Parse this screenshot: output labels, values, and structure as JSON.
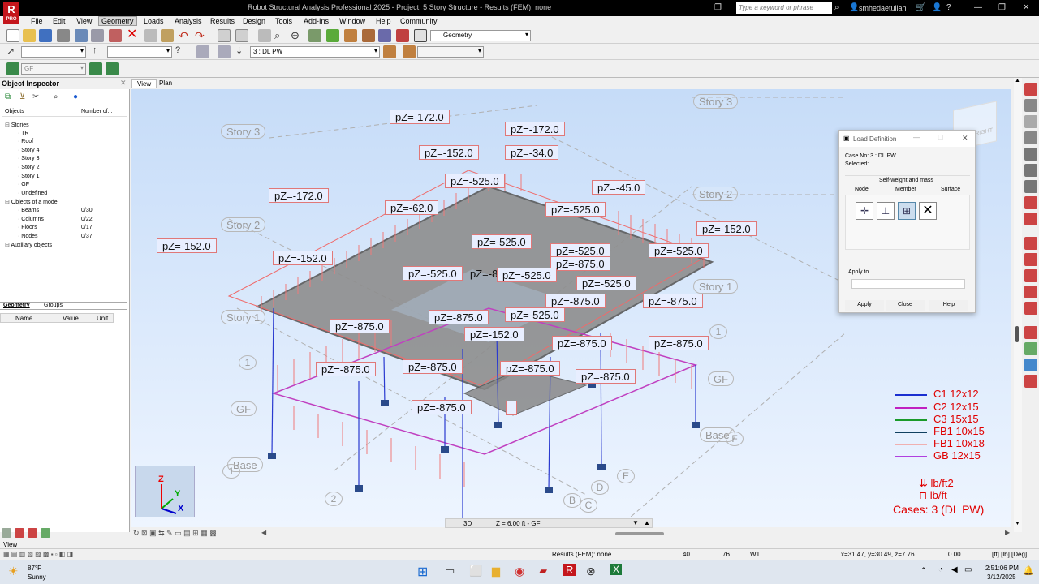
{
  "window": {
    "title": "Robot Structural Analysis Professional 2025 - Project: 5 Story Structure - Results (FEM): none",
    "search_placeholder": "Type a keyword or phrase",
    "user": "smhedaetullah"
  },
  "logo": {
    "letter": "R",
    "sub": "PRO"
  },
  "menu": [
    "File",
    "Edit",
    "View",
    "Geometry",
    "Loads",
    "Analysis",
    "Results",
    "Design",
    "Tools",
    "Add-Ins",
    "Window",
    "Help",
    "Community"
  ],
  "menu_active": "Geometry",
  "toolbar": {
    "layout_combo": "Geometry",
    "case_combo": "3 : DL PW",
    "story_combo": "GF"
  },
  "inspector": {
    "title": "Object Inspector",
    "cols": [
      "Objects",
      "Number of..."
    ],
    "tree": [
      {
        "label": "Stories",
        "level": 1,
        "count": ""
      },
      {
        "label": "TR",
        "level": 2,
        "count": ""
      },
      {
        "label": "Roof",
        "level": 2,
        "count": ""
      },
      {
        "label": "Story 4",
        "level": 2,
        "count": ""
      },
      {
        "label": "Story 3",
        "level": 2,
        "count": ""
      },
      {
        "label": "Story 2",
        "level": 2,
        "count": ""
      },
      {
        "label": "Story 1",
        "level": 2,
        "count": ""
      },
      {
        "label": "GF",
        "level": 2,
        "count": ""
      },
      {
        "label": "Undefined",
        "level": 2,
        "count": ""
      },
      {
        "label": "Objects of a model",
        "level": 1,
        "count": ""
      },
      {
        "label": "Beams",
        "level": 2,
        "count": "0/30"
      },
      {
        "label": "Columns",
        "level": 2,
        "count": "0/22"
      },
      {
        "label": "Floors",
        "level": 2,
        "count": "0/17"
      },
      {
        "label": "Nodes",
        "level": 2,
        "count": "0/37"
      },
      {
        "label": "Auxiliary objects",
        "level": 1,
        "count": ""
      }
    ],
    "tabs": [
      "Geometry",
      "Groups"
    ],
    "prop_cols": [
      "Name",
      "Value",
      "Unit"
    ]
  },
  "view_tabs": [
    "View",
    "Plan"
  ],
  "loads": [
    {
      "t": "pZ=-172.0"
    },
    {
      "t": "pZ=-172.0"
    },
    {
      "t": "pZ=-152.0"
    },
    {
      "t": "pZ=-34.0"
    },
    {
      "t": "pZ=-525.0"
    },
    {
      "t": "pZ=-172.0"
    },
    {
      "t": "pZ=-45.0"
    },
    {
      "t": "pZ=-62.0"
    },
    {
      "t": "pZ=-525.0"
    },
    {
      "t": "pZ=-152.0"
    },
    {
      "t": "pZ=-152.0"
    },
    {
      "t": "pZ=-525.0"
    },
    {
      "t": "pZ=-152.0"
    },
    {
      "t": "pZ=-525.0"
    },
    {
      "t": "pZ=-875.0"
    },
    {
      "t": "pZ=-525.0"
    },
    {
      "t": "pZ=-525.0"
    },
    {
      "t": "pZ=-875"
    },
    {
      "t": "pZ=-525.0"
    },
    {
      "t": "pZ=-525.0"
    },
    {
      "t": "pZ=-875.0"
    },
    {
      "t": "pZ=-875.0"
    },
    {
      "t": "pZ=-875.0"
    },
    {
      "t": "pZ=-525.0"
    },
    {
      "t": "pZ=-875.0"
    },
    {
      "t": "pZ=-152.0"
    },
    {
      "t": "pZ=-875.0"
    },
    {
      "t": "pZ=-875.0"
    },
    {
      "t": "pZ=-875.0"
    },
    {
      "t": "pZ=-875.0"
    },
    {
      "t": "pZ=-875.0"
    },
    {
      "t": "pZ=-875.0"
    },
    {
      "t": "pZ=-875.0"
    }
  ],
  "stories": [
    "Story 3",
    "Story 3",
    "Story 2",
    "Story 2",
    "Story 1",
    "Story 1",
    "GF",
    "GF",
    "Base",
    "Base"
  ],
  "grid_marks": [
    "1",
    "1",
    "2",
    "B",
    "C",
    "D",
    "E",
    "1",
    "F"
  ],
  "legend": {
    "items": [
      {
        "label": "C1 12x12",
        "color": "#1a2fd0"
      },
      {
        "label": "C2 12x15",
        "color": "#c020c0"
      },
      {
        "label": "C3 15x15",
        "color": "#1a9a2a"
      },
      {
        "label": "FB1 10x15",
        "color": "#104060"
      },
      {
        "label": "FB1 10x18",
        "color": "#f0b0b0"
      },
      {
        "label": "GB 12x15",
        "color": "#b040e0"
      }
    ],
    "units": [
      "lb/ft2",
      "lb/ft"
    ],
    "cases": "Cases: 3 (DL PW)"
  },
  "dialog": {
    "title": "Load Definition",
    "case": "Case No: 3 : DL PW",
    "selected": "Selected:",
    "group": "Self-weight and mass",
    "tabs": [
      "Node",
      "Member",
      "Surface"
    ],
    "apply_to": "Apply to",
    "buttons": [
      "Apply",
      "Close",
      "Help"
    ]
  },
  "viewport_bar": {
    "mode": "3D",
    "z": "Z = 6.00 ft - GF"
  },
  "status": {
    "left": "View",
    "results": "Results (FEM): none",
    "n1": "40",
    "n2": "76",
    "wt": "WT",
    "coords": "x=31.47, y=30.49, z=7.76",
    "zero": "0.00",
    "units": "[ft] [lb] [Deg]"
  },
  "taskbar": {
    "temp": "87°F",
    "weather": "Sunny",
    "time": "2:51:06 PM",
    "date": "3/12/2025"
  },
  "axes": {
    "z": "Z",
    "y": "Y",
    "x": "X"
  },
  "cube": "RIGHT"
}
